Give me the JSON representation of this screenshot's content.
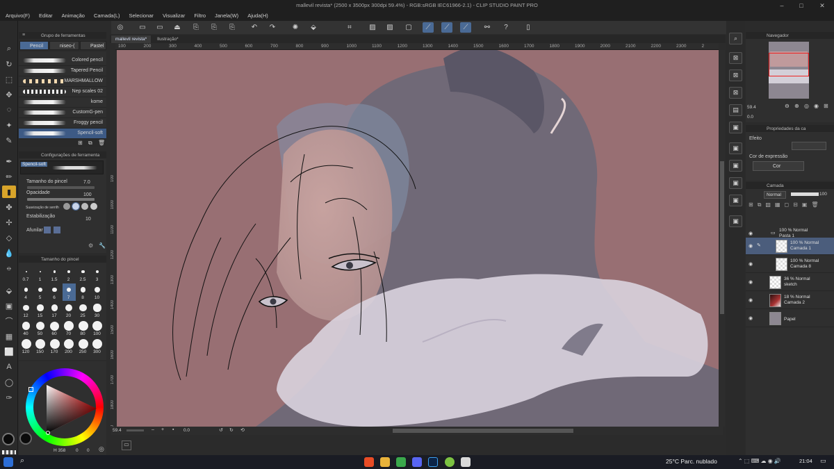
{
  "window": {
    "title": "mallevil revista* (2500 x 3500px 300dpi 59.4%) - RGB:sRGB IEC61966-2.1) - CLIP STUDIO PAINT PRO"
  },
  "menu": [
    "Arquivo(F)",
    "Editar",
    "Animação",
    "Camada(L)",
    "Selecionar",
    "Visualizar",
    "Filtro",
    "Janela(W)",
    "Ajuda(H)"
  ],
  "doc_tabs": [
    {
      "label": "mallevil revista*",
      "active": true
    },
    {
      "label": "Ilustração*",
      "active": false
    }
  ],
  "ruler_ticks": [
    "100",
    "200",
    "300",
    "400",
    "500",
    "600",
    "700",
    "800",
    "900",
    "1000",
    "1100",
    "1200",
    "1300",
    "1400",
    "1500",
    "1600",
    "1700",
    "1800",
    "1900",
    "2000",
    "2100",
    "2200",
    "2300",
    "2"
  ],
  "ruler_left_ticks": [
    "100",
    "1000",
    "1100",
    "1200",
    "1300",
    "1400",
    "1500",
    "1600",
    "1700",
    "1800",
    "1900"
  ],
  "subtool_panel": {
    "title": "Grupo de ferramentas",
    "tabs": [
      "Pencil",
      "niseo-(",
      "Pastel"
    ],
    "brushes": [
      "Colored pencil",
      "Tapered Pencil",
      "MARSHMALLOW",
      "Nep scales 02",
      "kome",
      "CustomG-pen",
      "Froggy pencil",
      "Spencil-soft"
    ],
    "selected_brush": "Spencil-soft"
  },
  "tool_property": {
    "title": "Configurações de ferramenta",
    "preview_label": "Spencil-soft",
    "brush_size_label": "Tamanho do pincel",
    "brush_size_value": "7.0",
    "opacity_label": "Opacidade",
    "opacity_value": "100",
    "antialias_label": "Suavização de serrilh",
    "stabilization_label": "Estabilização",
    "stabilization_value": "10",
    "taper_label": "Afunilar"
  },
  "brush_size_panel": {
    "title": "Tamanho do pincel",
    "sizes": [
      "0.7",
      "1",
      "1.5",
      "2",
      "2.5",
      "3",
      "4",
      "5",
      "6",
      "7",
      "8",
      "10",
      "12",
      "15",
      "17",
      "20",
      "25",
      "30",
      "40",
      "50",
      "60",
      "70",
      "80",
      "100",
      "120",
      "150",
      "170",
      "200",
      "250",
      "300"
    ],
    "selected": "7"
  },
  "color": {
    "hue_value": "358",
    "s_value": "0",
    "v_value": "0",
    "main": "#0b0b0b",
    "sub": "#0b0b0b"
  },
  "canvas_status": {
    "zoom": "59.4",
    "angle": "0.0"
  },
  "navigator": {
    "title": "Navegador",
    "zoom": "59.4",
    "rotation": "0.0"
  },
  "layer_property": {
    "title": "Propriedades da ca",
    "effect_label": "Efeito",
    "expression_label": "Cor de expressão",
    "expression_value": "Cor"
  },
  "layer_panel": {
    "title": "Camada",
    "blend_mode": "Normal",
    "opacity": "100",
    "layers": [
      {
        "pct": "100 % Normal",
        "name": "Pasta 1",
        "type": "folder"
      },
      {
        "pct": "100 % Normal",
        "name": "Camada 1",
        "type": "raster",
        "selected": true
      },
      {
        "pct": "100 % Normal",
        "name": "Camada 8",
        "type": "raster"
      },
      {
        "pct": "36 % Normal",
        "name": "sketch",
        "type": "raster"
      },
      {
        "pct": "18 % Normal",
        "name": "Camada 2",
        "type": "image"
      },
      {
        "pct": "",
        "name": "Papel",
        "type": "paper"
      }
    ]
  },
  "taskbar": {
    "weather": "25°C  Parc. nublado",
    "time": "21:04"
  },
  "colors": {
    "canvas_bg": "#986f73",
    "accent": "#4a6a95",
    "active_tool": "#d8a42a"
  }
}
